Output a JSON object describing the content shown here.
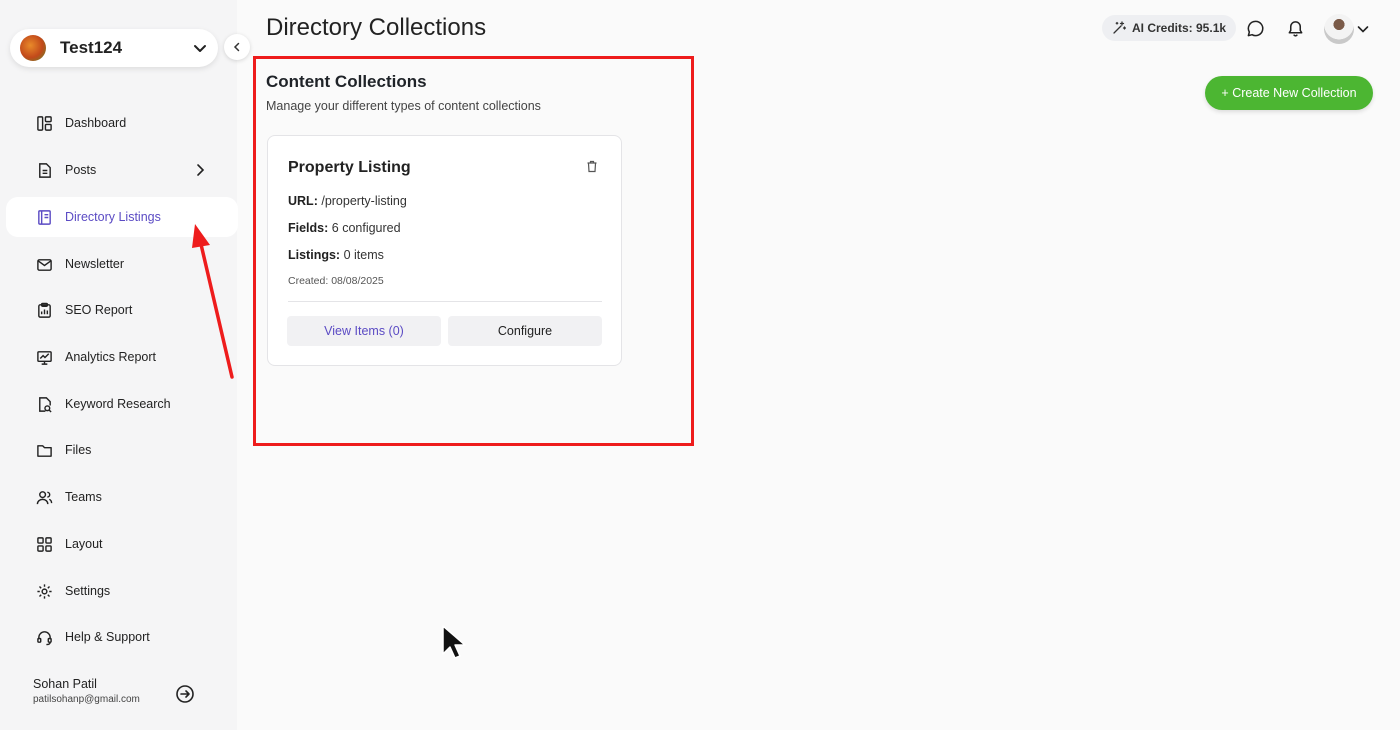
{
  "workspace": {
    "name": "Test124"
  },
  "sidebar": {
    "items": [
      {
        "label": "Dashboard",
        "icon": "dashboard-icon"
      },
      {
        "label": "Posts",
        "icon": "file-icon"
      },
      {
        "label": "Directory Listings",
        "icon": "book-icon"
      },
      {
        "label": "Newsletter",
        "icon": "mail-icon"
      },
      {
        "label": "SEO Report",
        "icon": "clipboard-chart-icon"
      },
      {
        "label": "Analytics Report",
        "icon": "monitor-chart-icon"
      },
      {
        "label": "Keyword Research",
        "icon": "file-search-icon"
      },
      {
        "label": "Files",
        "icon": "folder-icon"
      },
      {
        "label": "Teams",
        "icon": "users-icon"
      },
      {
        "label": "Layout",
        "icon": "grid-icon"
      },
      {
        "label": "Settings",
        "icon": "gear-icon"
      },
      {
        "label": "Help & Support",
        "icon": "headset-icon"
      }
    ],
    "active": "Directory Listings",
    "user": {
      "name": "Sohan Patil",
      "email": "patilsohanp@gmail.com"
    }
  },
  "header": {
    "title": "Directory Collections",
    "credits": "AI Credits: 95.1k"
  },
  "main": {
    "create_label": "+ Create New Collection",
    "section_title": "Content Collections",
    "section_subtitle": "Manage your different types of content collections",
    "cards": [
      {
        "title": "Property Listing",
        "url_label": "URL:",
        "url_value": "/property-listing",
        "fields_label": "Fields:",
        "fields_value": "6 configured",
        "listings_label": "Listings:",
        "listings_value": "0 items",
        "created": "Created: 08/08/2025",
        "view_label": "View Items (0)",
        "configure_label": "Configure"
      }
    ]
  },
  "colors": {
    "accent": "#5b4bc4",
    "create_button": "#4cb632",
    "annotation": "#ee1c1c"
  }
}
